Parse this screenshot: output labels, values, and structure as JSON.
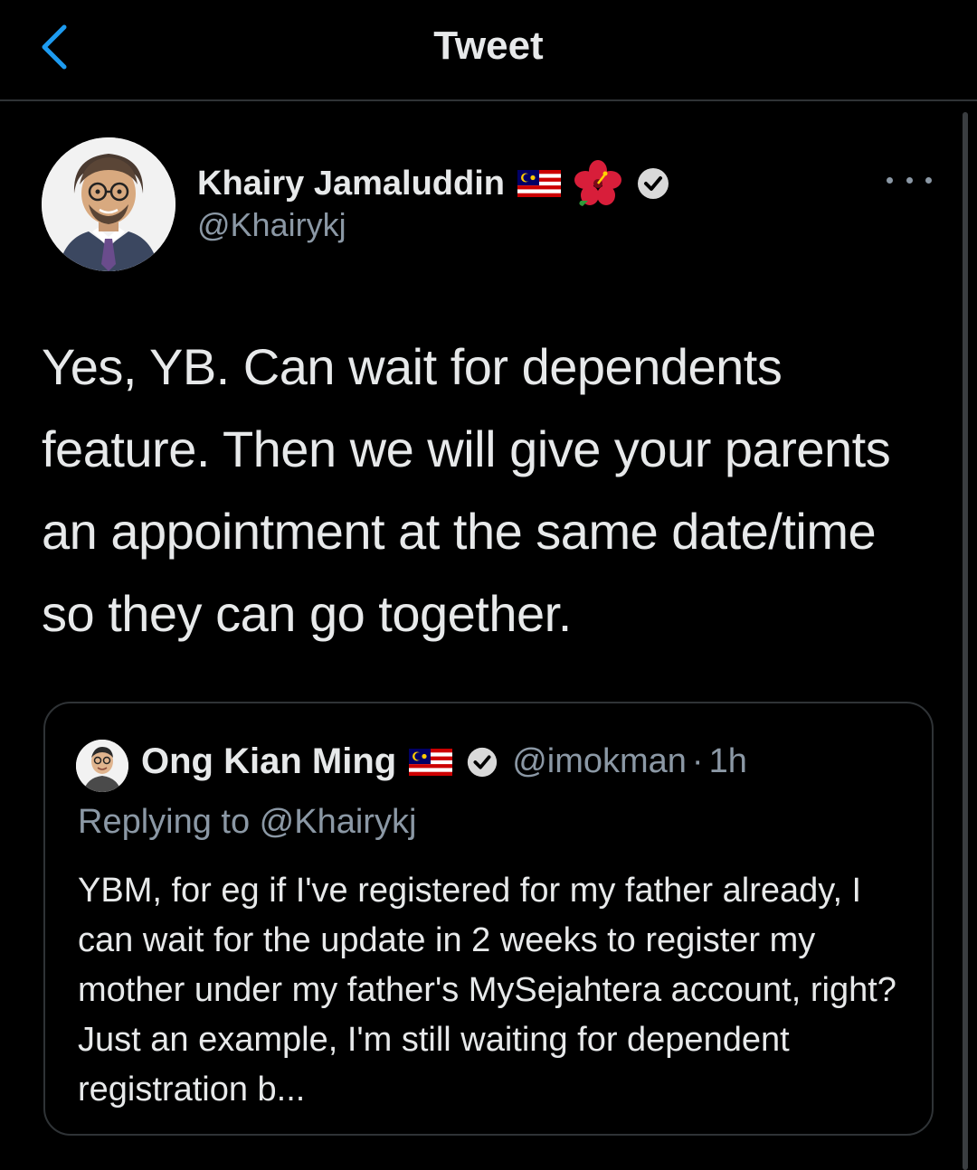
{
  "header": {
    "title": "Tweet",
    "back_icon": "chevron-left-icon"
  },
  "tweet": {
    "author_name": "Khairy Jamaluddin",
    "author_handle": "@Khairykj",
    "badges": [
      "malaysia-flag-icon",
      "hibiscus-icon",
      "verified-badge-icon"
    ],
    "text": "Yes, YB.  Can wait for dependents feature. Then we will give your parents an appointment at the same date/time so they can go together."
  },
  "quoted_tweet": {
    "author_name": "Ong Kian Ming",
    "author_handle": "@imokman",
    "separator": "·",
    "time": "1h",
    "replying_to": "Replying to @Khairykj",
    "text": "YBM, for eg if I've registered for my father already, I can wait for the update in 2 weeks to register my mother under my father's MySejahtera account, right? Just an example, I'm still waiting for dependent registration b..."
  },
  "colors": {
    "background": "#000000",
    "primary_text": "#e7e9ea",
    "secondary_text": "#8b98a5",
    "accent": "#1d9bf0",
    "border": "#2f3336"
  }
}
